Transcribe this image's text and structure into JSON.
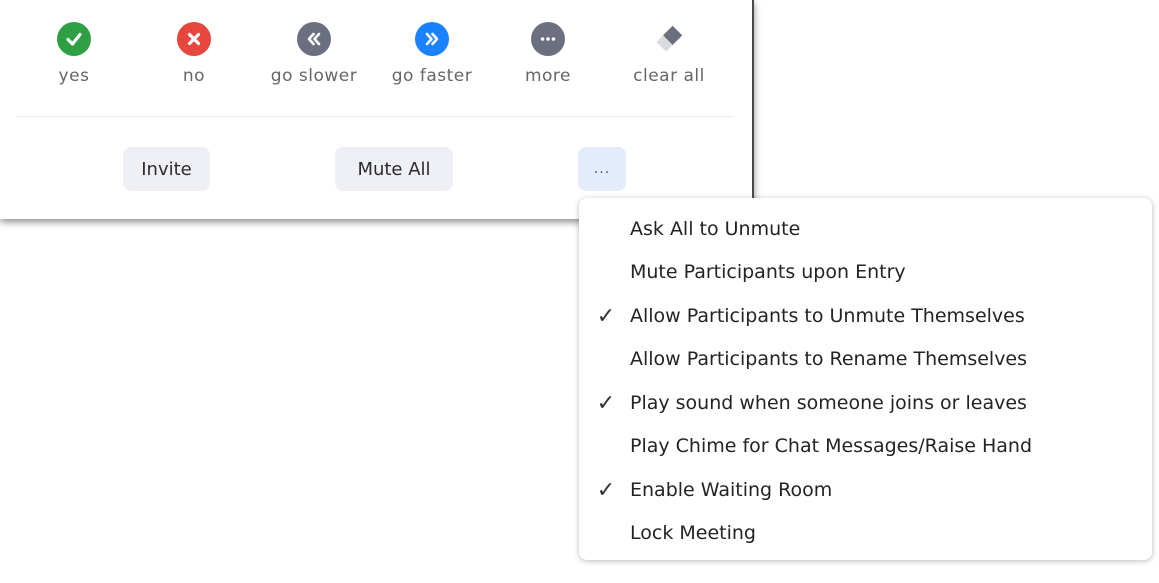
{
  "reactions": [
    {
      "label": "yes",
      "icon": "check-icon",
      "color": "#2ea043"
    },
    {
      "label": "no",
      "icon": "x-icon",
      "color": "#e5473c"
    },
    {
      "label": "go slower",
      "icon": "rewind-icon",
      "color": "#6b6f80"
    },
    {
      "label": "go faster",
      "icon": "fast-forward-icon",
      "color": "#1a82ff"
    },
    {
      "label": "more",
      "icon": "ellipsis-icon",
      "color": "#6b6f80"
    },
    {
      "label": "clear all",
      "icon": "eraser-icon",
      "color": "#6b6f80"
    }
  ],
  "actions": {
    "invite_label": "Invite",
    "mute_all_label": "Mute All",
    "more_label": "..."
  },
  "menu": {
    "items": [
      {
        "label": "Ask All to Unmute",
        "checked": false
      },
      {
        "label": "Mute Participants upon Entry",
        "checked": false
      },
      {
        "label": "Allow Participants to Unmute Themselves",
        "checked": true
      },
      {
        "label": "Allow Participants to Rename Themselves",
        "checked": false
      },
      {
        "label": "Play sound when someone joins or leaves",
        "checked": true
      },
      {
        "label": "Play Chime for Chat Messages/Raise Hand",
        "checked": false
      },
      {
        "label": "Enable Waiting Room",
        "checked": true
      },
      {
        "label": "Lock Meeting",
        "checked": false
      }
    ],
    "check_glyph": "✓"
  }
}
